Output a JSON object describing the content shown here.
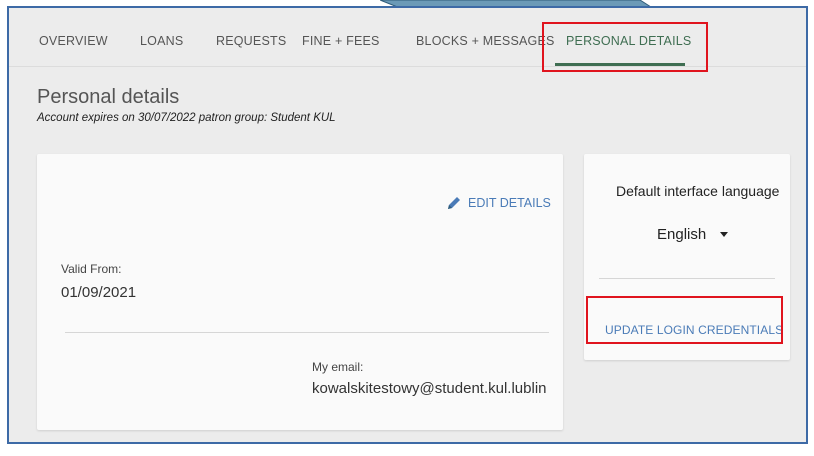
{
  "tabs": [
    {
      "label": "OVERVIEW"
    },
    {
      "label": "LOANS"
    },
    {
      "label": "REQUESTS"
    },
    {
      "label": "FINE + FEES"
    },
    {
      "label": "BLOCKS + MESSAGES"
    },
    {
      "label": "PERSONAL DETAILS",
      "active": true
    }
  ],
  "page": {
    "title": "Personal details",
    "subtitle": "Account expires on 30/07/2022 patron group: Student KUL"
  },
  "details": {
    "edit_label": "EDIT DETAILS",
    "valid_from_label": "Valid From:",
    "valid_from_value": "01/09/2021",
    "email_label": "My email:",
    "email_value": "kowalskitestowy@student.kul.lublin"
  },
  "language": {
    "title": "Default interface language",
    "selected": "English"
  },
  "credentials": {
    "update_label": "UPDATE LOGIN CREDENTIALS"
  },
  "colors": {
    "active_tab": "#3f6e52",
    "link": "#4a7bb7",
    "highlight": "#e0141e",
    "frame_border": "#3d6aa6"
  }
}
